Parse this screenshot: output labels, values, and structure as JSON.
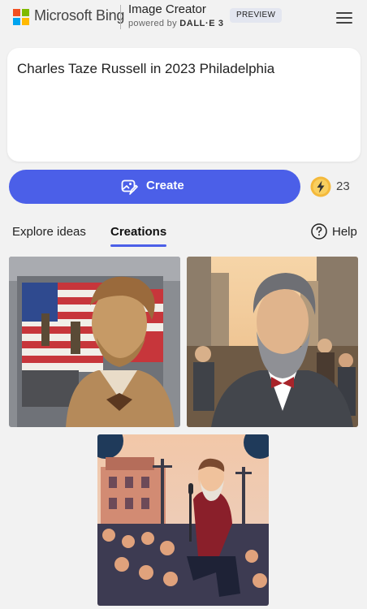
{
  "header": {
    "brand": "Microsoft Bing",
    "product_title": "Image Creator",
    "powered_by": "powered by",
    "powered_by_model": "DALL·E 3",
    "badge": "PREVIEW"
  },
  "prompt": {
    "text": "Charles Taze Russell in 2023 Philadelphia"
  },
  "create": {
    "label": "Create",
    "boosts": "23"
  },
  "tabs": [
    {
      "label": "Explore ideas",
      "active": false
    },
    {
      "label": "Creations",
      "active": true
    }
  ],
  "help": {
    "label": "Help"
  },
  "colors": {
    "accent": "#4b5fe8",
    "background": "#f2f2f2",
    "boost": "#f4b93b"
  },
  "images": [
    {
      "icon": "bronze-bust-with-flag-image"
    },
    {
      "icon": "bearded-man-city-crowd-image"
    },
    {
      "icon": "speaker-microphone-crowd-image"
    }
  ]
}
